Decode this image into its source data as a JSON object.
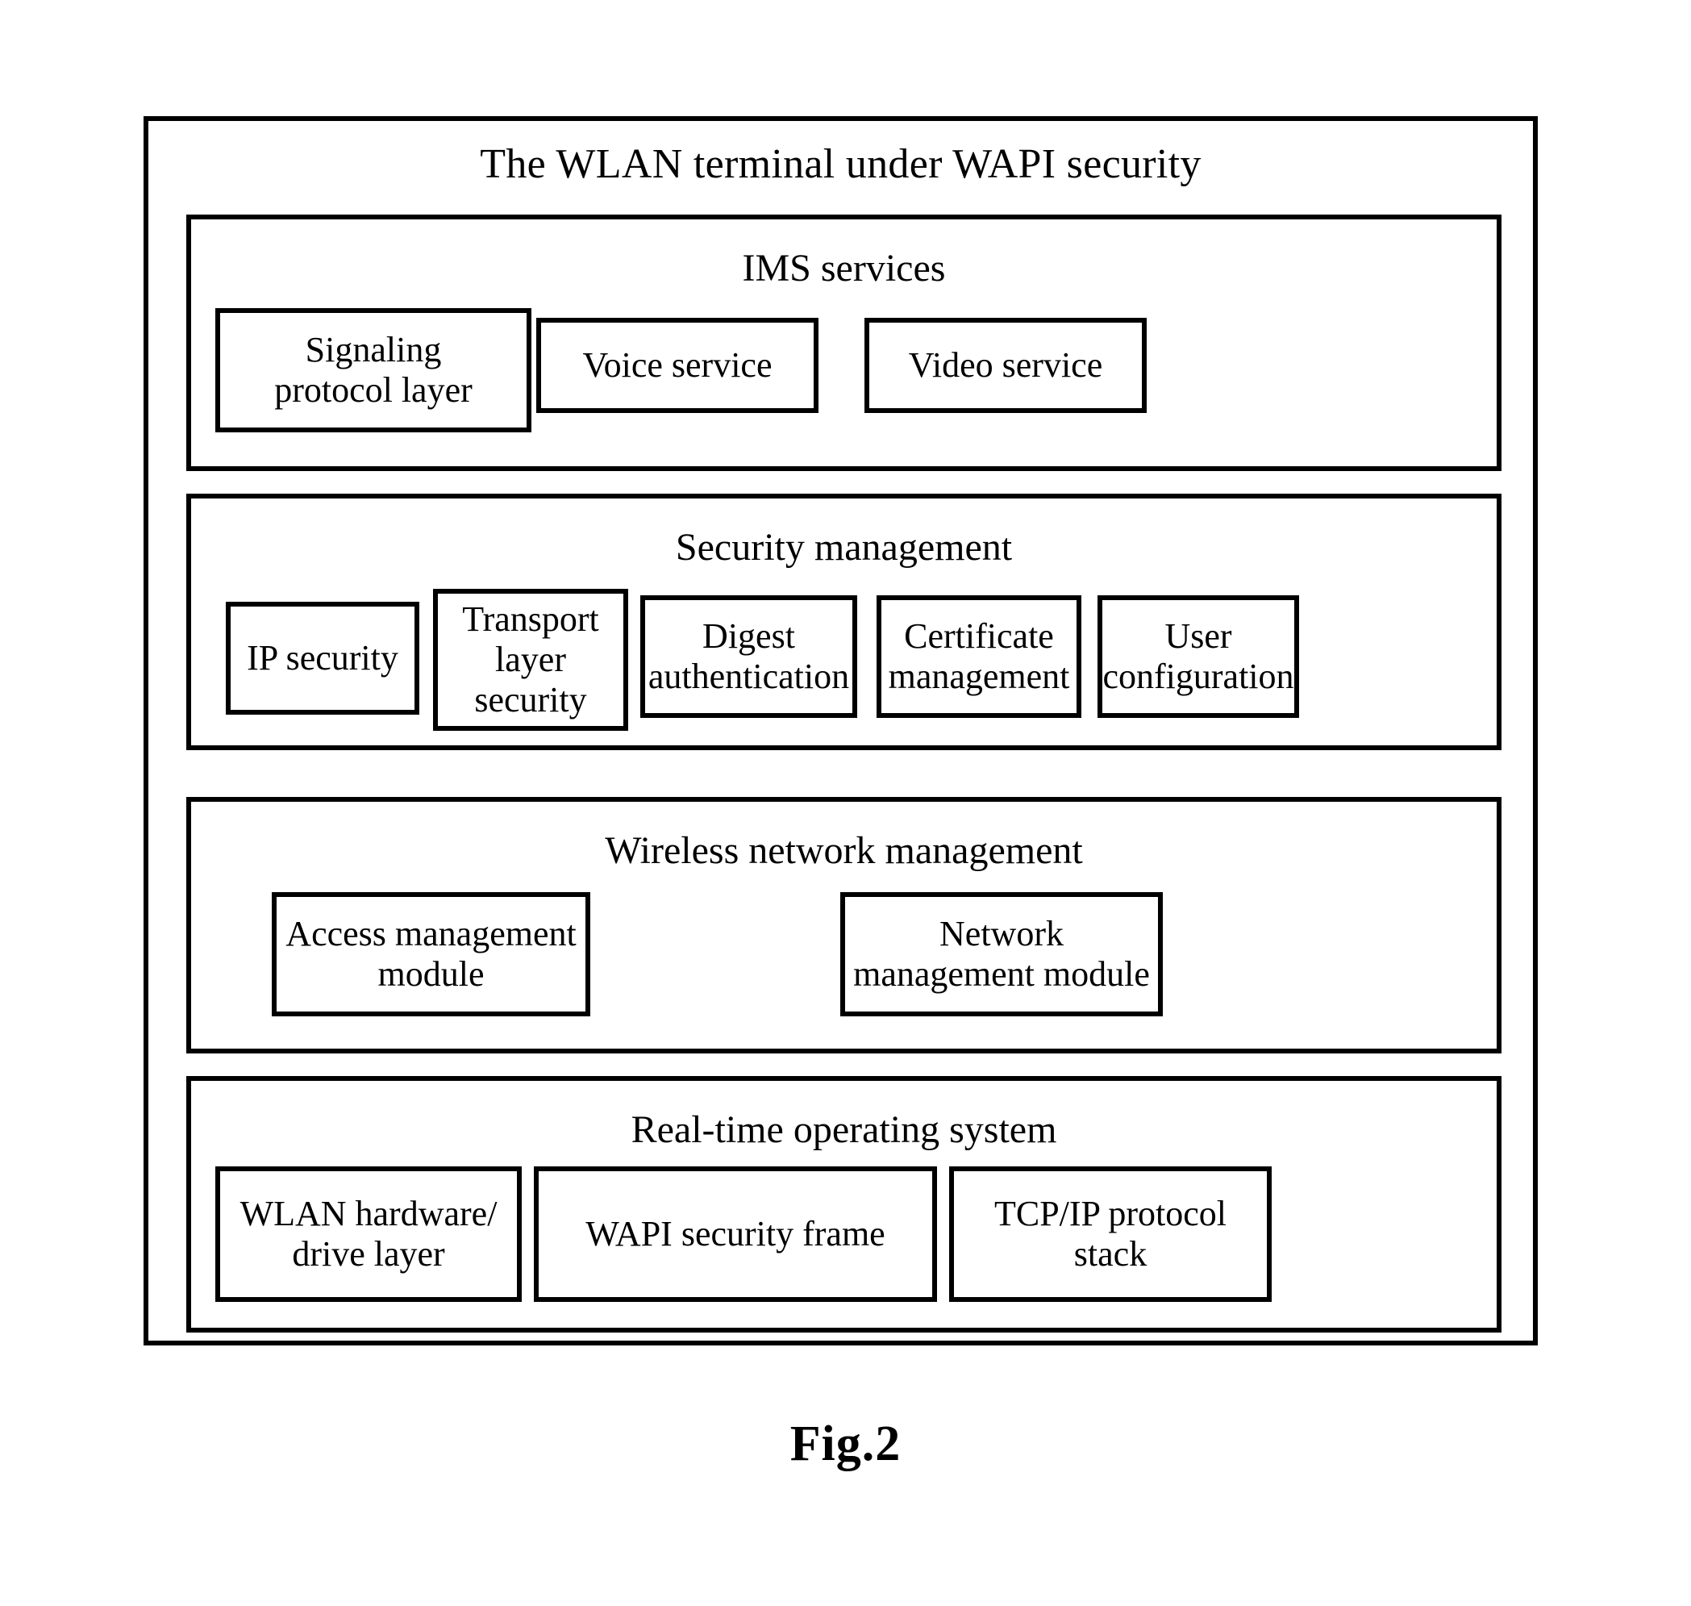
{
  "figure": {
    "caption": "Fig.2"
  },
  "terminal": {
    "title": "The WLAN terminal under WAPI security",
    "sections": [
      {
        "id": "ims",
        "title": "IMS services",
        "modules": [
          {
            "id": "signaling-protocol-layer",
            "label": "Signaling\nprotocol layer"
          },
          {
            "id": "voice-service",
            "label": "Voice service"
          },
          {
            "id": "video-service",
            "label": "Video service"
          }
        ]
      },
      {
        "id": "security",
        "title": "Security management",
        "modules": [
          {
            "id": "ip-security",
            "label": "IP security"
          },
          {
            "id": "transport-layer-security",
            "label": "Transport\nlayer\nsecurity"
          },
          {
            "id": "digest-authentication",
            "label": "Digest\nauthentication"
          },
          {
            "id": "certificate-management",
            "label": "Certificate\nmanagement"
          },
          {
            "id": "user-configuration",
            "label": "User\nconfiguration"
          }
        ]
      },
      {
        "id": "wireless",
        "title": "Wireless network management",
        "modules": [
          {
            "id": "access-management-module",
            "label": "Access management\nmodule"
          },
          {
            "id": "network-management-module",
            "label": "Network\nmanagement module"
          }
        ]
      },
      {
        "id": "rtos",
        "title": "Real-time operating system",
        "modules": [
          {
            "id": "wlan-hardware-drive-layer",
            "label": "WLAN hardware/\ndrive layer"
          },
          {
            "id": "wapi-security-frame",
            "label": "WAPI security frame"
          },
          {
            "id": "tcpip-protocol-stack",
            "label": "TCP/IP protocol\nstack"
          }
        ]
      }
    ]
  },
  "colors": {
    "stroke": "#000000",
    "background": "#ffffff"
  }
}
